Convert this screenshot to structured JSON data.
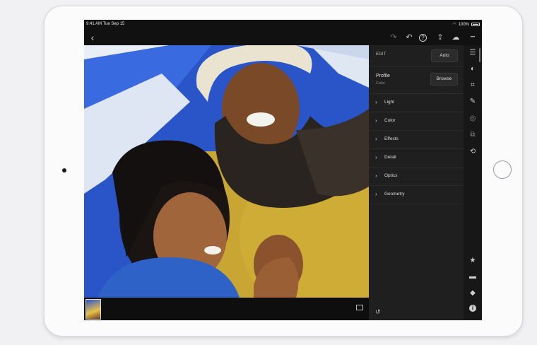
{
  "status_bar": {
    "time": "9:41 AM  Tue Sep 15",
    "battery": "100%"
  },
  "toolbar": {
    "icons": [
      "back-icon",
      "redo-icon",
      "undo-icon",
      "help-icon",
      "share-icon",
      "cloud-icon",
      "more-icon"
    ],
    "back_glyph": "‹",
    "redo_glyph": "↷",
    "undo_glyph": "↶",
    "help_glyph": "?",
    "share_glyph": "⇪",
    "cloud_glyph": "☁",
    "more_glyph": "•••"
  },
  "edit_panel": {
    "edit_label": "EDIT",
    "auto_label": "Auto",
    "profile_label": "Profile",
    "profile_value": "Color",
    "browse_label": "Browse",
    "sections": [
      "Light",
      "Color",
      "Effects",
      "Detail",
      "Optics",
      "Geometry"
    ],
    "section_glyph": "›",
    "reset_glyph": "↺"
  },
  "rail": {
    "icons": [
      "sliders-icon",
      "presets-icon",
      "crop-icon",
      "brush-icon",
      "healing-icon",
      "versions-icon",
      "history-icon",
      "star-icon",
      "comment-icon",
      "tag-icon",
      "info-icon"
    ],
    "glyphs": [
      "☰",
      "◐",
      "⌗",
      "✎",
      "◎",
      "⧉",
      "⟲",
      "★",
      "▬",
      "◆",
      "i"
    ]
  },
  "colors": {
    "screen_bg": "#111111",
    "panel_bg": "#1f1f1f",
    "device": "#fbfbfc"
  }
}
